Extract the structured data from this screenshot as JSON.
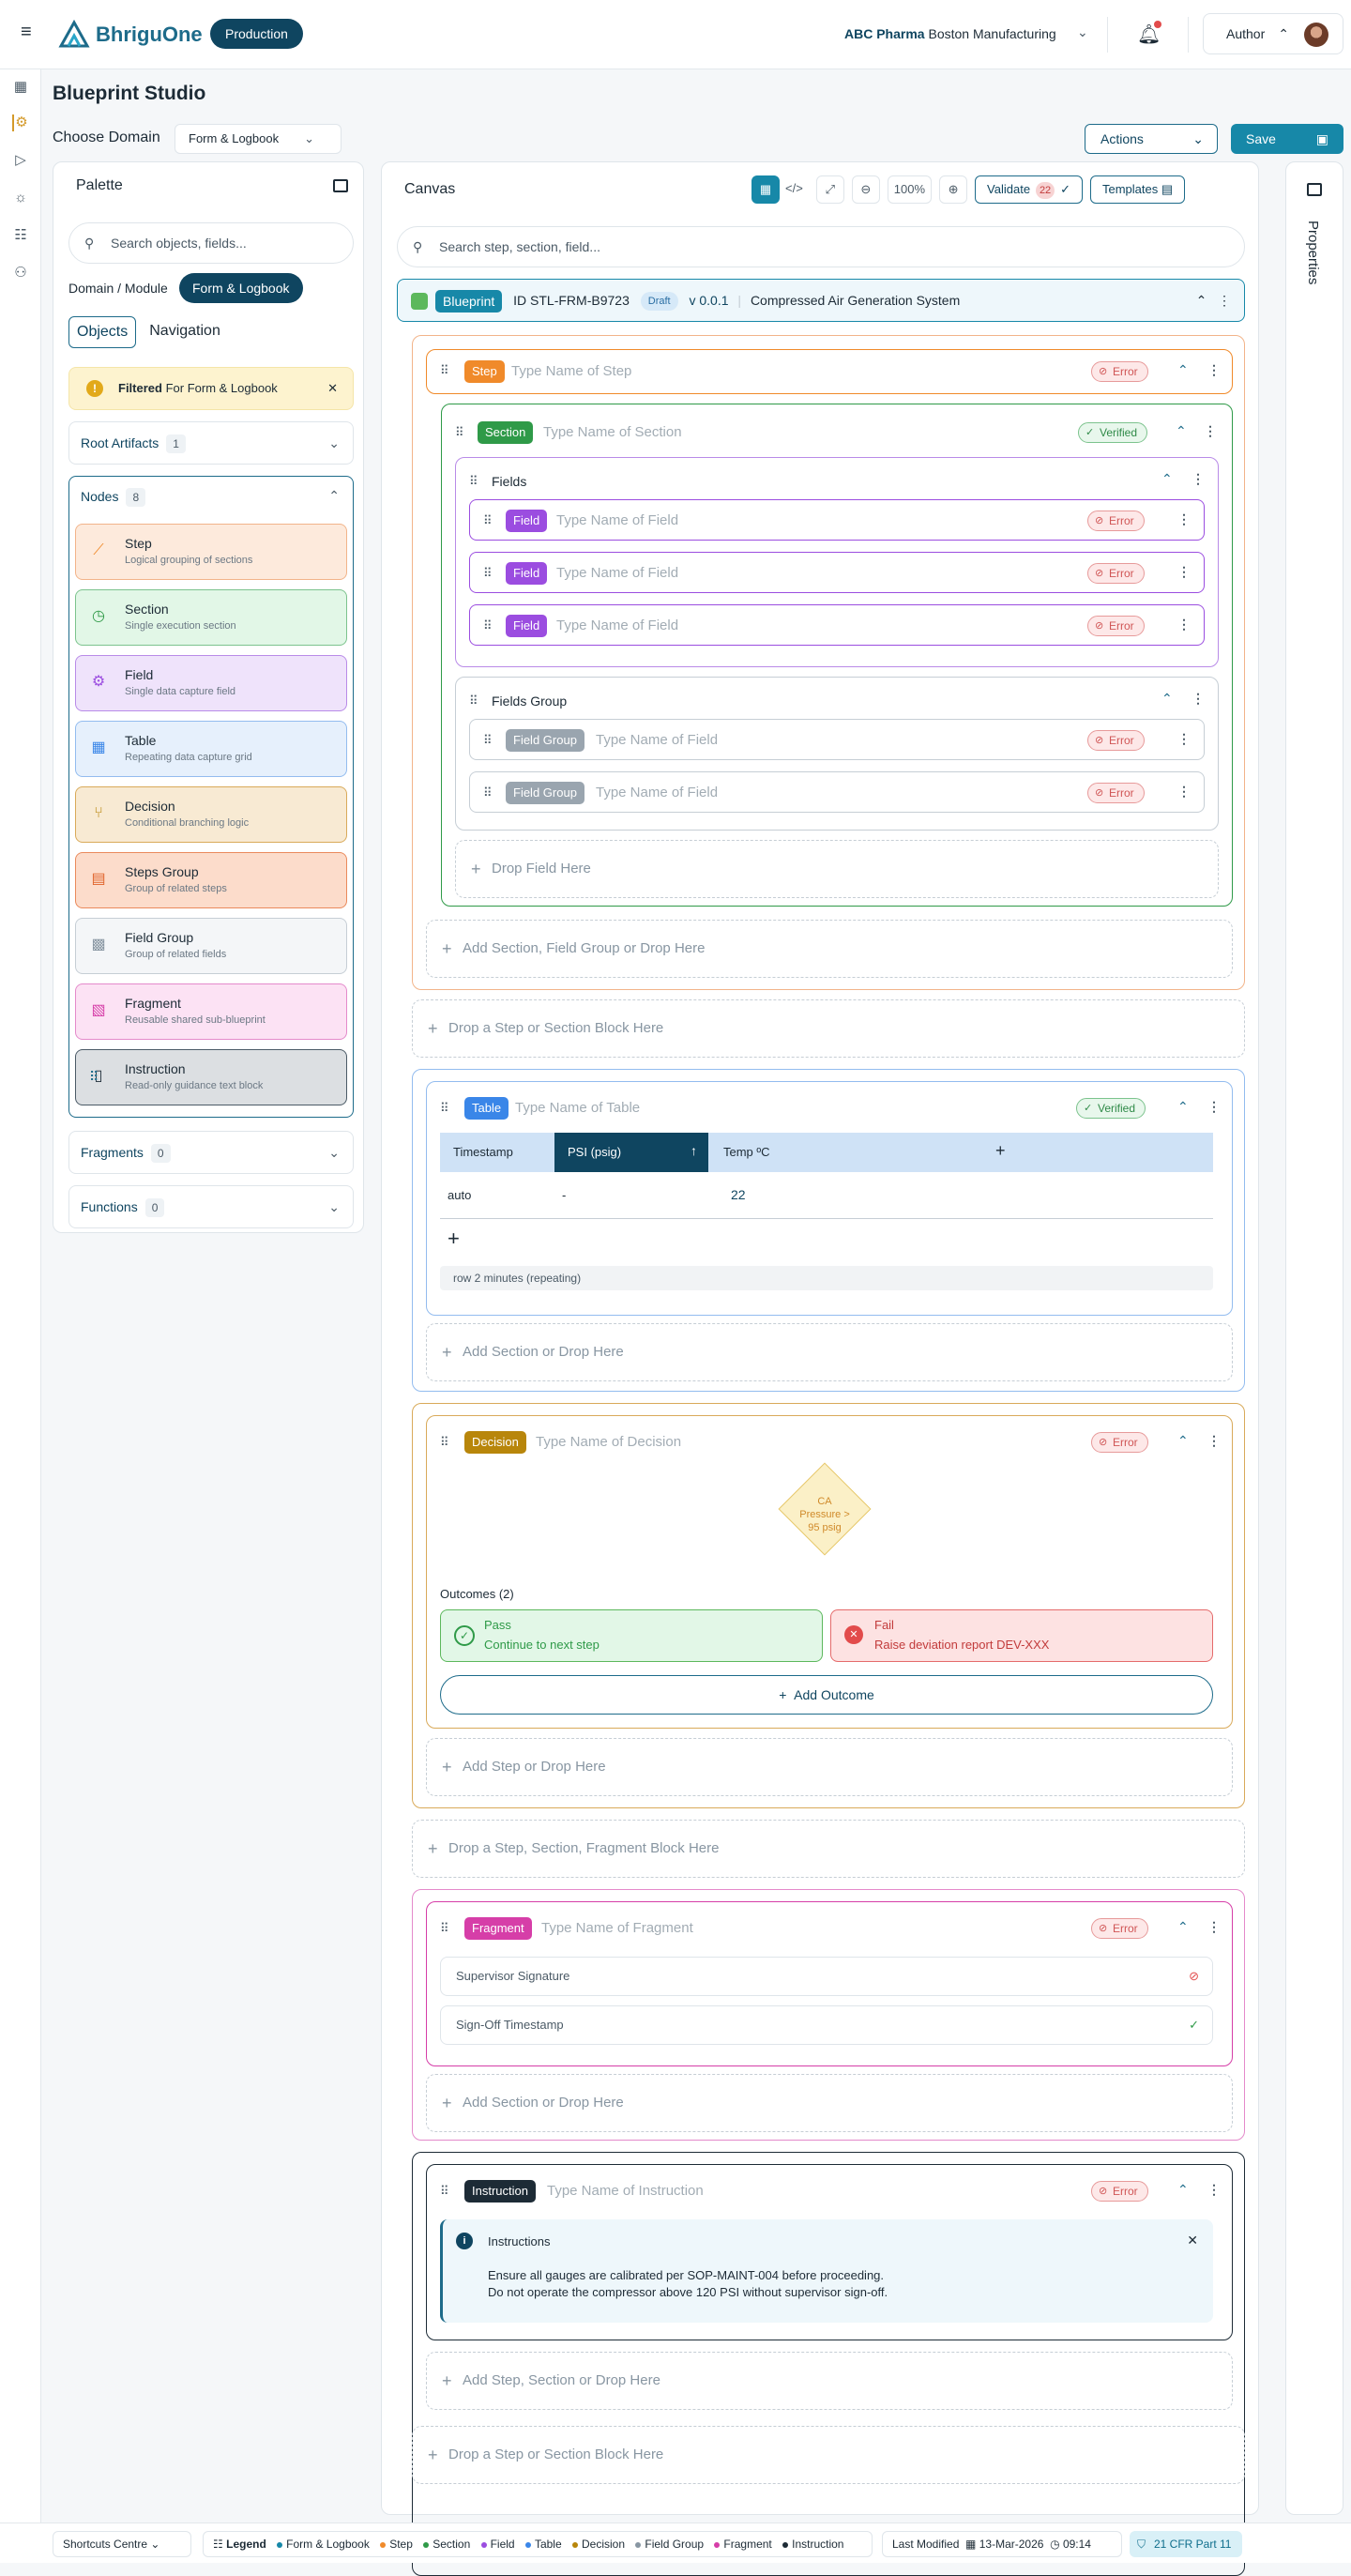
{
  "header": {
    "brand": "BhriguOne",
    "env": "Production",
    "org_bold": "ABC Pharma",
    "org_rest": "Boston Manufacturing",
    "role": "Author"
  },
  "page": {
    "title": "Blueprint Studio",
    "choose_domain_label": "Choose Domain",
    "domain_value": "Form & Logbook",
    "actions_label": "Actions",
    "save_label": "Save"
  },
  "palette": {
    "title": "Palette",
    "search_placeholder": "Search objects, fields...",
    "domain_module_label": "Domain / Module",
    "domain_module_value": "Form & Logbook",
    "tabs": [
      "Objects",
      "Navigation"
    ],
    "filter_bold": "Filtered",
    "filter_rest": "For Form & Logbook",
    "root_artifacts": {
      "label": "Root Artifacts",
      "count": "1"
    },
    "nodes_header": {
      "label": "Nodes",
      "count": "8"
    },
    "nodes": [
      {
        "title": "Step",
        "desc": "Logical grouping of sections"
      },
      {
        "title": "Section",
        "desc": "Single execution section"
      },
      {
        "title": "Field",
        "desc": "Single data capture field"
      },
      {
        "title": "Table",
        "desc": "Repeating data capture grid"
      },
      {
        "title": "Decision",
        "desc": "Conditional branching logic"
      },
      {
        "title": "Steps Group",
        "desc": "Group of related steps"
      },
      {
        "title": "Field Group",
        "desc": "Group of related fields"
      },
      {
        "title": "Fragment",
        "desc": "Reusable shared sub-blueprint"
      },
      {
        "title": "Instruction",
        "desc": "Read-only guidance text block"
      }
    ],
    "fragments": {
      "label": "Fragments",
      "count": "0"
    },
    "functions": {
      "label": "Functions",
      "count": "0"
    }
  },
  "canvas": {
    "title": "Canvas",
    "zoom": "100%",
    "validate_label": "Validate",
    "validate_count": "22",
    "templates_label": "Templates",
    "search_placeholder": "Search step, section, field...",
    "blueprint": {
      "tag": "Blueprint",
      "id": "ID STL-FRM-B9723",
      "status": "Draft",
      "version": "v 0.0.1",
      "name": "Compressed Air Generation System"
    },
    "step": {
      "chip": "Step",
      "placeholder": "Type Name of Step",
      "status": "Error"
    },
    "section": {
      "chip": "Section",
      "placeholder": "Type Name of Section",
      "status": "Verified"
    },
    "fields_label": "Fields",
    "field_chip": "Field",
    "field_placeholder": "Type Name of Field",
    "error_label": "Error",
    "fields_group_label": "Fields Group",
    "field_group_chip": "Field Group",
    "drop_field": "Drop Field Here",
    "add_section_fg": "Add Section, Field Group or Drop Here",
    "drop_step_section": "Drop a Step or Section Block Here",
    "table": {
      "chip": "Table",
      "placeholder": "Type Name of Table",
      "status": "Verified",
      "columns": [
        "Timestamp",
        "PSI (psig)",
        "Temp ºC"
      ],
      "row": [
        "auto",
        "-",
        "22"
      ],
      "note": "row 2 minutes (repeating)"
    },
    "add_section": "Add Section or Drop Here",
    "decision": {
      "chip": "Decision",
      "placeholder": "Type Name of Decision",
      "status": "Error",
      "condition": "CA Pressure > 95 psig",
      "outcomes_label": "Outcomes (2)",
      "pass_title": "Pass",
      "pass_desc": "Continue to next step",
      "fail_title": "Fail",
      "fail_desc": "Raise deviation report DEV-XXX",
      "add_outcome": "Add Outcome"
    },
    "add_step": "Add Step or Drop Here",
    "drop_step_section_fragment": "Drop a Step, Section, Fragment Block Here",
    "fragment": {
      "chip": "Fragment",
      "placeholder": "Type Name of Fragment",
      "status": "Error",
      "rows": [
        "Supervisor Signature",
        "Sign-Off Timestamp"
      ]
    },
    "instruction": {
      "chip": "Instruction",
      "placeholder": "Type Name of Instruction",
      "status": "Error",
      "box_title": "Instructions",
      "line1": "Ensure all gauges are calibrated per SOP-MAINT-004 before proceeding.",
      "line2": "Do not operate the compressor above 120 PSI without supervisor sign-off."
    },
    "add_step_section": "Add Step, Section or Drop Here",
    "drop_final": "Drop a Step or Section Block Here"
  },
  "right_panel": {
    "label": "Properties"
  },
  "footer": {
    "shortcuts": "Shortcuts Centre",
    "legend_label": "Legend",
    "legend": [
      {
        "name": "Form & Logbook",
        "color": "#1788a8"
      },
      {
        "name": "Step",
        "color": "#f08a2a"
      },
      {
        "name": "Section",
        "color": "#2f9a48"
      },
      {
        "name": "Field",
        "color": "#9b4de0"
      },
      {
        "name": "Table",
        "color": "#3a86e8"
      },
      {
        "name": "Decision",
        "color": "#b8860b"
      },
      {
        "name": "Field Group",
        "color": "#8896a2"
      },
      {
        "name": "Fragment",
        "color": "#d63ea8"
      },
      {
        "name": "Instruction",
        "color": "#1d2b36"
      }
    ],
    "last_modified_label": "Last Modified",
    "date": "13-Mar-2026",
    "time": "09:14",
    "compliance": "21 CFR Part 11"
  }
}
